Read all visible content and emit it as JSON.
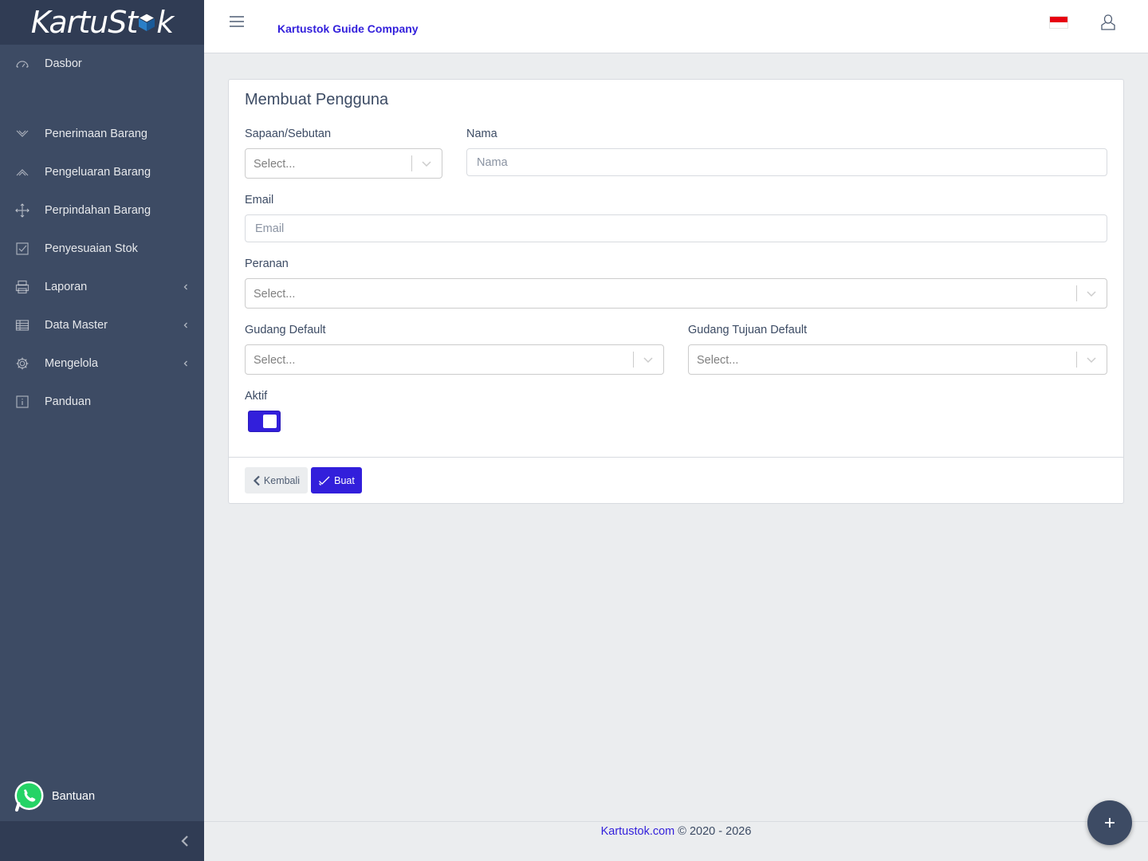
{
  "brand": {
    "name_part1": "KartuSt",
    "name_part2": "k"
  },
  "sidebar": {
    "items": [
      {
        "label": "Dasbor",
        "icon": "speedometer-icon"
      },
      {
        "label": "Penerimaan Barang",
        "icon": "chevron-down-icon"
      },
      {
        "label": "Pengeluaran Barang",
        "icon": "chevron-up-icon"
      },
      {
        "label": "Perpindahan Barang",
        "icon": "move-icon"
      },
      {
        "label": "Penyesuaian Stok",
        "icon": "check-square-icon"
      },
      {
        "label": "Laporan",
        "icon": "printer-icon"
      },
      {
        "label": "Data Master",
        "icon": "spreadsheet-icon"
      },
      {
        "label": "Mengelola",
        "icon": "gear-icon"
      },
      {
        "label": "Panduan",
        "icon": "info-icon"
      }
    ],
    "help_label": "Bantuan"
  },
  "header": {
    "company": "Kartustok Guide Company"
  },
  "form": {
    "title": "Membuat Pengguna",
    "salutation_label": "Sapaan/Sebutan",
    "salutation_placeholder": "Select...",
    "name_label": "Nama",
    "name_placeholder": "Nama",
    "email_label": "Email",
    "email_placeholder": "Email",
    "role_label": "Peranan",
    "role_placeholder": "Select...",
    "default_warehouse_label": "Gudang Default",
    "default_warehouse_placeholder": "Select...",
    "default_target_warehouse_label": "Gudang Tujuan Default",
    "default_target_warehouse_placeholder": "Select...",
    "active_label": "Aktif",
    "active": true,
    "back_label": "Kembali",
    "create_label": "Buat"
  },
  "footer": {
    "link": "Kartustok.com",
    "copyright": "© 2020 - 2026"
  },
  "colors": {
    "primary": "#321fdb",
    "sidebar": "#3d4b64",
    "sidebar_dark": "#303c54",
    "whatsapp": "#25d366"
  }
}
